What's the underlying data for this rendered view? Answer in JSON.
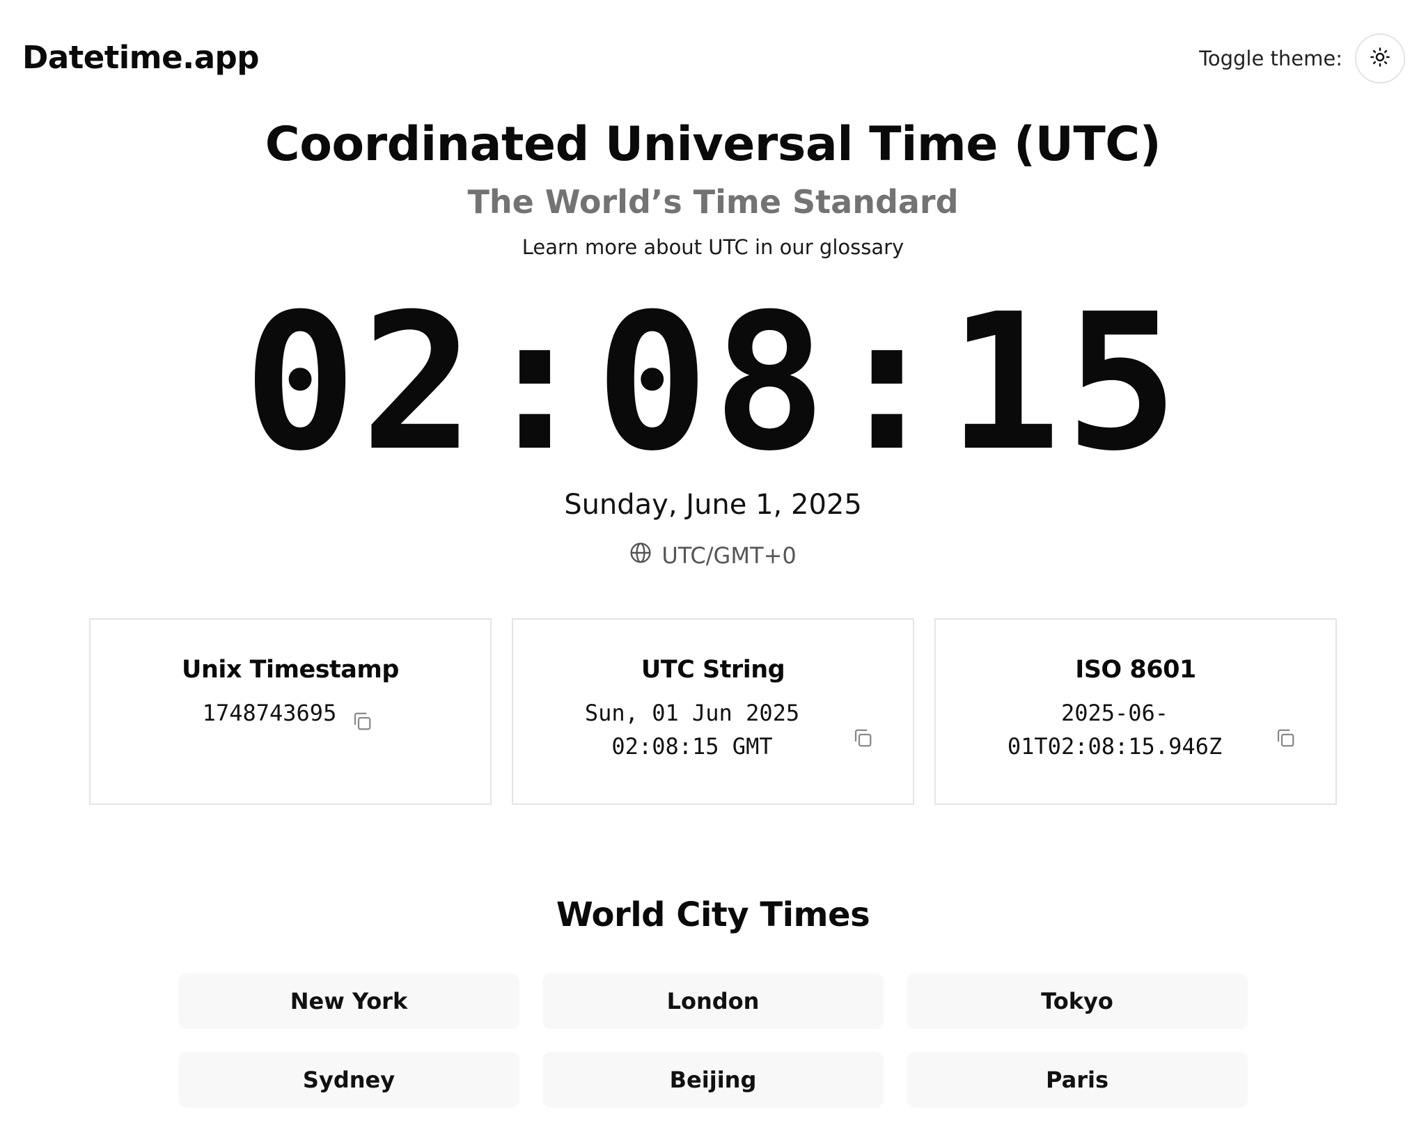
{
  "header": {
    "logo": "Datetime.app",
    "theme_label": "Toggle theme:",
    "theme_icon": "sun-icon"
  },
  "hero": {
    "title": "Coordinated Universal Time (UTC)",
    "subtitle": "The World’s Time Standard",
    "glossary_link": "Learn more about UTC in our glossary"
  },
  "clock": {
    "time": "02:08:15",
    "date": "Sunday, June 1, 2025",
    "timezone": "UTC/GMT+0",
    "timezone_icon": "globe-icon"
  },
  "cards": [
    {
      "title": "Unix Timestamp",
      "value": "1748743695"
    },
    {
      "title": "UTC String",
      "value_line1": "Sun, 01 Jun 2025",
      "value_line2": "02:08:15 GMT"
    },
    {
      "title": "ISO 8601",
      "value_line1": "2025-06-",
      "value_line2": "01T02:08:15.946Z"
    }
  ],
  "world": {
    "title": "World City Times",
    "cities": [
      "New York",
      "London",
      "Tokyo",
      "Sydney",
      "Beijing",
      "Paris"
    ]
  },
  "colors": {
    "text": "#0a0a0a",
    "muted": "#737373",
    "border": "#e4e4e7",
    "city_bg": "#f8f8f8"
  }
}
